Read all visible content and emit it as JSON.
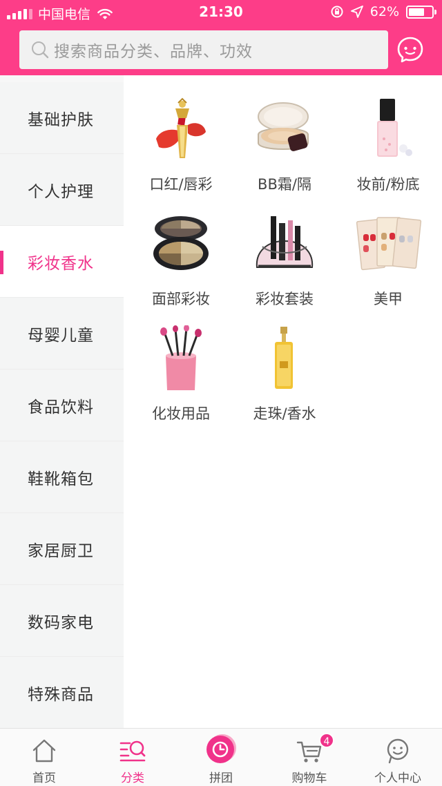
{
  "status_bar": {
    "carrier": "中国电信",
    "time": "21:30",
    "battery": "62%"
  },
  "header": {
    "search_placeholder": "搜索商品分类、品牌、功效",
    "accent_color": "#fd3d88",
    "message_icon": "chat-bubble-icon"
  },
  "sidebar": {
    "active_index": 2,
    "items": [
      {
        "label": "基础护肤"
      },
      {
        "label": "个人护理"
      },
      {
        "label": "彩妆香水"
      },
      {
        "label": "母婴儿童"
      },
      {
        "label": "食品饮料"
      },
      {
        "label": "鞋靴箱包"
      },
      {
        "label": "家居厨卫"
      },
      {
        "label": "数码家电"
      },
      {
        "label": "特殊商品"
      }
    ]
  },
  "content": {
    "subcategories": [
      {
        "label": "口红/唇彩",
        "icon": "lipstick-icon"
      },
      {
        "label": "BB霜/隔",
        "icon": "cushion-compact-icon"
      },
      {
        "label": "妆前/粉底",
        "icon": "foundation-bottle-icon"
      },
      {
        "label": "面部彩妆",
        "icon": "eyeshadow-palette-icon"
      },
      {
        "label": "彩妆套装",
        "icon": "makeup-set-icon"
      },
      {
        "label": "美甲",
        "icon": "nail-art-icon"
      },
      {
        "label": "化妆用品",
        "icon": "makeup-brushes-icon"
      },
      {
        "label": "走珠/香水",
        "icon": "perfume-bottle-icon"
      }
    ]
  },
  "tabbar": {
    "active_index": 1,
    "items": [
      {
        "label": "首页",
        "icon": "home-icon"
      },
      {
        "label": "分类",
        "icon": "category-search-icon"
      },
      {
        "label": "拼团",
        "icon": "group-buy-clock-icon"
      },
      {
        "label": "购物车",
        "icon": "cart-icon",
        "badge": "4"
      },
      {
        "label": "个人中心",
        "icon": "profile-icon"
      }
    ]
  }
}
